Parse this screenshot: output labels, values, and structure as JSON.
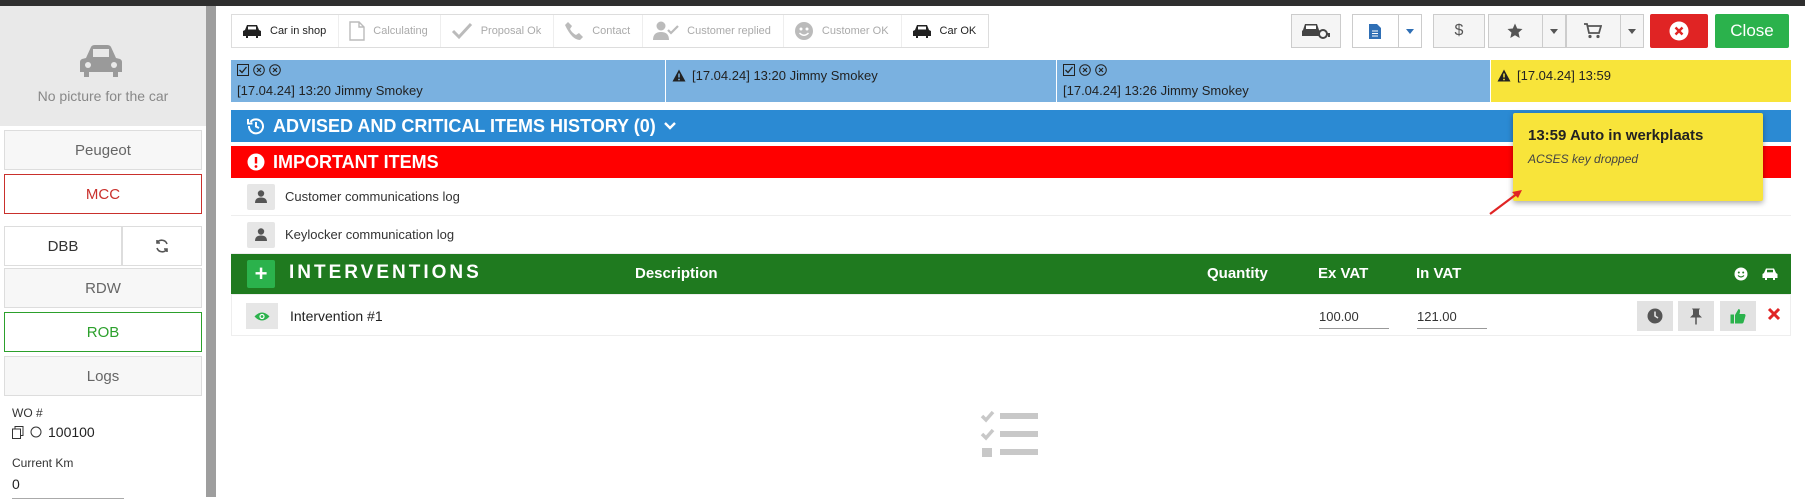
{
  "sidebar": {
    "no_picture": "No picture for the car",
    "buttons": [
      "Peugeot",
      "MCC",
      "DBB",
      "RDW",
      "ROB",
      "Logs"
    ],
    "wo_label": "WO #",
    "wo_value": "100100",
    "km_label": "Current Km",
    "km_value": "0"
  },
  "steps": [
    {
      "label": "Car in shop",
      "active": true,
      "icon": "car-icon"
    },
    {
      "label": "Calculating",
      "active": false,
      "icon": "document-icon"
    },
    {
      "label": "Proposal Ok",
      "active": false,
      "icon": "check-icon"
    },
    {
      "label": "Contact",
      "active": false,
      "icon": "phone-icon"
    },
    {
      "label": "Customer replied",
      "active": false,
      "icon": "user-check-icon"
    },
    {
      "label": "Customer OK",
      "active": false,
      "icon": "smile-icon"
    },
    {
      "label": "Car OK",
      "active": true,
      "icon": "car-icon"
    }
  ],
  "toolbar": {
    "close_label": "Close",
    "dollar": "$"
  },
  "events": [
    {
      "text": "[17.04.24] 13:20 Jimmy Smokey"
    },
    {
      "text": "[17.04.24] 13:20 Jimmy Smokey"
    },
    {
      "text": "[17.04.24] 13:26 Jimmy Smokey"
    },
    {
      "text": "[17.04.24] 13:59"
    }
  ],
  "history_bar": "ADVISED AND CRITICAL ITEMS HISTORY (0)",
  "important_bar": "IMPORTANT ITEMS",
  "logs": [
    "Customer communications log",
    "Keylocker communication log"
  ],
  "interventions": {
    "title": "INTERVENTIONS",
    "columns": {
      "description": "Description",
      "quantity": "Quantity",
      "ex_vat": "Ex VAT",
      "in_vat": "In VAT"
    },
    "rows": [
      {
        "name": "Intervention #1",
        "ex_vat": "100.00",
        "in_vat": "121.00"
      }
    ]
  },
  "tooltip": {
    "title": "13:59 Auto in werkplaats",
    "subtitle": "ACSES key dropped"
  },
  "colors": {
    "blue": "#2b8ad3",
    "red": "#ff0000",
    "green": "#1f7a1f",
    "yellow": "#f8e43a"
  }
}
